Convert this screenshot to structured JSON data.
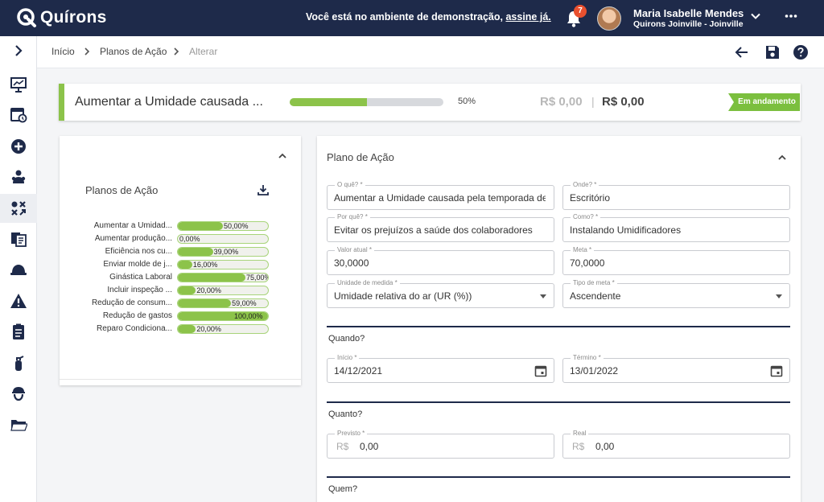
{
  "topbar": {
    "brand": "Quírons",
    "demo_message": "Você está no ambiente de demonstração,",
    "demo_link": "assine já.",
    "notification_count": "7",
    "user_name": "Maria Isabelle Mendes",
    "user_org": "Quirons Joinville - Joinville",
    "colors": {
      "background": "#1e2a4a",
      "badge": "#e8502f"
    }
  },
  "sidebar": {
    "items": [
      {
        "icon": "presentation-icon"
      },
      {
        "icon": "calendar-clock-icon"
      },
      {
        "icon": "plus-circle-icon"
      },
      {
        "icon": "users-icon"
      },
      {
        "icon": "action-plan-icon",
        "active": true
      },
      {
        "icon": "documents-icon"
      },
      {
        "icon": "helmet-icon"
      },
      {
        "icon": "warning-icon"
      },
      {
        "icon": "clipboard-icon"
      },
      {
        "icon": "fire-extinguisher-icon"
      },
      {
        "icon": "worker-icon"
      },
      {
        "icon": "folder-icon"
      }
    ]
  },
  "breadcrumb": {
    "items": [
      "Início",
      "Planos de Ação",
      "Alterar"
    ]
  },
  "summary": {
    "title": "Aumentar a Umidade causada ...",
    "progress": 0.5,
    "progress_label": "50%",
    "planned_cost": "R$ 0,00",
    "separator": "|",
    "real_cost": "R$ 0,00",
    "status": "Em andamento",
    "colors": {
      "accent": "#8cc34a",
      "status": "#7bbf3e"
    }
  },
  "plans_card": {
    "title": "Planos de Ação",
    "bars": [
      {
        "label": "Aumentar a Umidad...",
        "value": 0.5,
        "value_label": "50,00%"
      },
      {
        "label": "Aumentar produção...",
        "value": 0.0,
        "value_label": "0,00%"
      },
      {
        "label": "Eficiência nos cu...",
        "value": 0.39,
        "value_label": "39,00%"
      },
      {
        "label": "Enviar molde de j...",
        "value": 0.16,
        "value_label": "16,00%"
      },
      {
        "label": "Ginástica Laboral",
        "value": 0.75,
        "value_label": "75,00%"
      },
      {
        "label": "Incluir inspeção ...",
        "value": 0.2,
        "value_label": "20,00%"
      },
      {
        "label": "Redução de consum...",
        "value": 0.59,
        "value_label": "59,00%"
      },
      {
        "label": "Redução de gastos",
        "value": 1.0,
        "value_label": "100,00%"
      },
      {
        "label": "Reparo Condiciona...",
        "value": 0.2,
        "value_label": "20,00%"
      }
    ]
  },
  "plan_form": {
    "title": "Plano de Ação",
    "what": {
      "label": "O quê? *",
      "value": "Aumentar a Umidade causada pela temporada de seca"
    },
    "where": {
      "label": "Onde? *",
      "value": "Escritório"
    },
    "why": {
      "label": "Por quê? *",
      "value": "Evitar os prejuízos a saúde dos colaboradores"
    },
    "how": {
      "label": "Como? *",
      "value": "Instalando Umidificadores"
    },
    "current_value": {
      "label": "Valor atual *",
      "value": "30,0000"
    },
    "goal": {
      "label": "Meta *",
      "value": "70,0000"
    },
    "unit": {
      "label": "Unidade de medida *",
      "value": "Umidade relativa do ar (UR (%))"
    },
    "goal_type": {
      "label": "Tipo de meta *",
      "value": "Ascendente"
    },
    "when_title": "Quando?",
    "start": {
      "label": "Início *",
      "value": "14/12/2021"
    },
    "end": {
      "label": "Término *",
      "value": "13/01/2022"
    },
    "how_much_title": "Quanto?",
    "planned": {
      "label": "Previsto *",
      "prefix": "R$",
      "value": "0,00"
    },
    "real": {
      "label": "Real",
      "prefix": "R$",
      "value": "0,00"
    },
    "who_title": "Quem?"
  }
}
